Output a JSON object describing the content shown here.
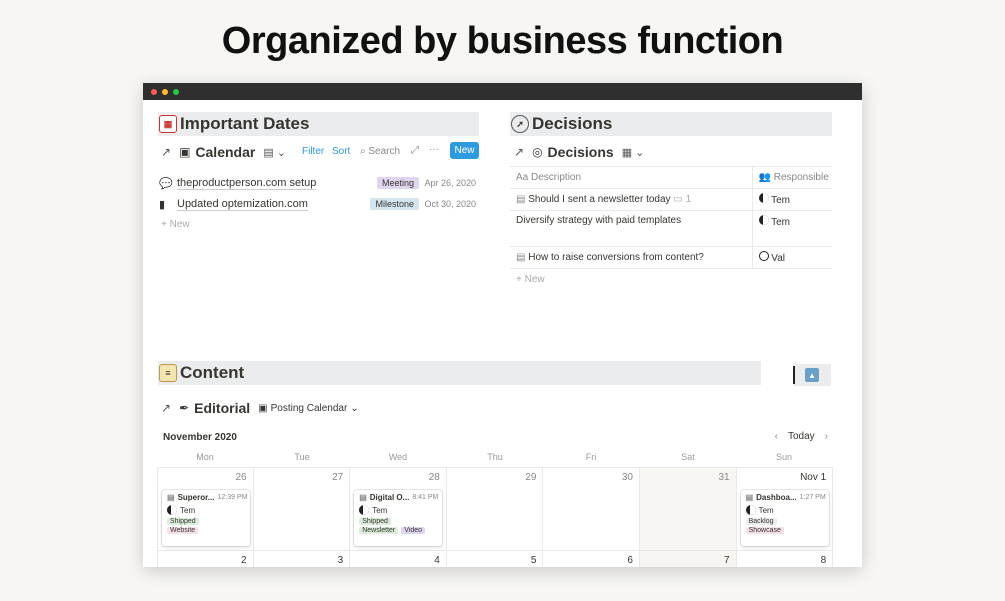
{
  "hero": {
    "title": "Organized by business function"
  },
  "dates": {
    "header": "Important Dates",
    "view_title": "Calendar",
    "tools": {
      "filter": "Filter",
      "sort": "Sort",
      "search": "Search",
      "more": "···",
      "new": "New"
    },
    "rows": [
      {
        "title": "theproductperson.com setup",
        "tag": "Meeting",
        "date": "Apr 26, 2020"
      },
      {
        "title": "Updated optemization.com",
        "tag": "Milestone",
        "date": "Oct 30, 2020"
      }
    ],
    "new_label": "New"
  },
  "decisions": {
    "header": "Decisions",
    "view_title": "Decisions",
    "col_description": "Description",
    "col_responsible": "Responsible",
    "rows": [
      {
        "description": "Should I sent a newsletter today",
        "comments": "1",
        "responsible": "Tem"
      },
      {
        "description": "Diversify strategy with paid templates",
        "responsible": "Tem"
      },
      {
        "description": "How to raise conversions from content?",
        "responsible": "Val"
      }
    ],
    "new_label": "New"
  },
  "content": {
    "header": "Content",
    "view_title": "Editorial",
    "view_select": "Posting Calendar",
    "month": "November 2020",
    "today_label": "Today",
    "weekdays": [
      "Mon",
      "Tue",
      "Wed",
      "Thu",
      "Fri",
      "Sat",
      "Sun"
    ],
    "week1": [
      "26",
      "27",
      "28",
      "29",
      "30",
      "31",
      "Nov 1"
    ],
    "week2": [
      "2",
      "3",
      "4",
      "5",
      "6",
      "7",
      "8"
    ],
    "cards": [
      {
        "title": "Superor...",
        "time": "12:39 PM",
        "person": "Tem",
        "tag1": "Shipped",
        "tag2": "Website"
      },
      {
        "title": "Digital O...",
        "time": "8:41 PM",
        "person": "Tem",
        "tag1": "Shipped",
        "tag2": "Newsletter",
        "tag3": "Video"
      },
      {
        "title": "Dashboa...",
        "time": "1:27 PM",
        "person": "Tem",
        "tag1": "Backlog",
        "tag2": "Showcase"
      }
    ]
  },
  "colors": {
    "accent": "#2e9be0",
    "section_bg": "#ebeced"
  }
}
